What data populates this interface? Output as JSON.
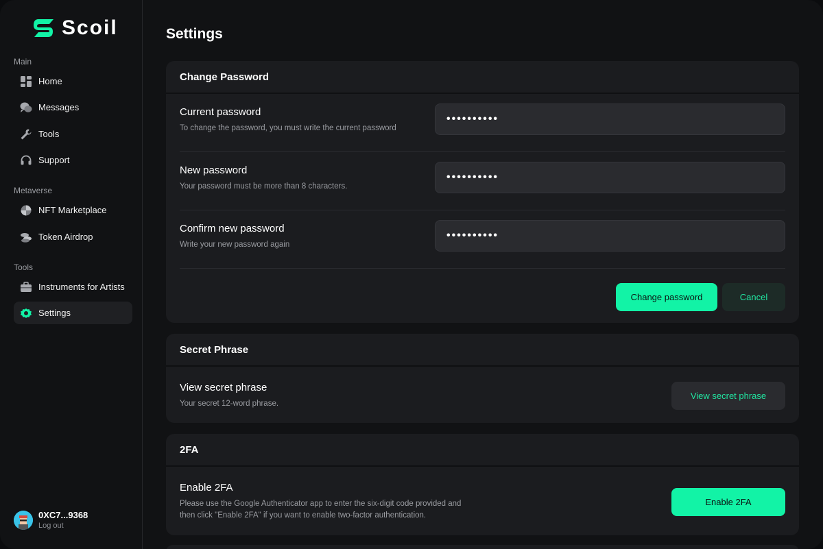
{
  "brand": {
    "name": "Scoil",
    "accent": "#12f3a6"
  },
  "sidebar": {
    "sections": [
      {
        "label": "Main"
      },
      {
        "label": "Metaverse"
      },
      {
        "label": "Tools"
      }
    ],
    "items": [
      {
        "label": "Home",
        "icon": "grid-icon"
      },
      {
        "label": "Messages",
        "icon": "chat-icon"
      },
      {
        "label": "Tools",
        "icon": "wrench-icon"
      },
      {
        "label": "Support",
        "icon": "headset-icon"
      },
      {
        "label": "NFT Marketplace",
        "icon": "marketplace-icon"
      },
      {
        "label": "Token Airdrop",
        "icon": "coins-icon"
      },
      {
        "label": "Instruments for Artists",
        "icon": "toolbox-icon"
      },
      {
        "label": "Settings",
        "icon": "gear-icon",
        "active": true
      }
    ],
    "user": {
      "address": "0XC7...9368",
      "logout": "Log out"
    }
  },
  "page": {
    "title": "Settings"
  },
  "change_password": {
    "header": "Change Password",
    "current": {
      "title": "Current password",
      "desc": "To change the password, you must write the current password",
      "value": "••••••••••"
    },
    "new": {
      "title": "New password",
      "desc": "Your password must be more than 8 characters.",
      "value": "••••••••••"
    },
    "confirm": {
      "title": "Confirm new password",
      "desc": "Write your new password again",
      "value": "••••••••••"
    },
    "submit": "Change password",
    "cancel": "Cancel"
  },
  "secret_phrase": {
    "header": "Secret Phrase",
    "title": "View secret phrase",
    "desc": "Your secret 12-word phrase.",
    "button": "View secret phrase"
  },
  "twofa": {
    "header": "2FA",
    "title": "Enable 2FA",
    "desc_line1": "Please use the Google Authenticator app to enter the six-digit code provided and",
    "desc_line2": "then click \"Enable 2FA\" if you want to enable two-factor authentication.",
    "button": "Enable 2FA"
  }
}
